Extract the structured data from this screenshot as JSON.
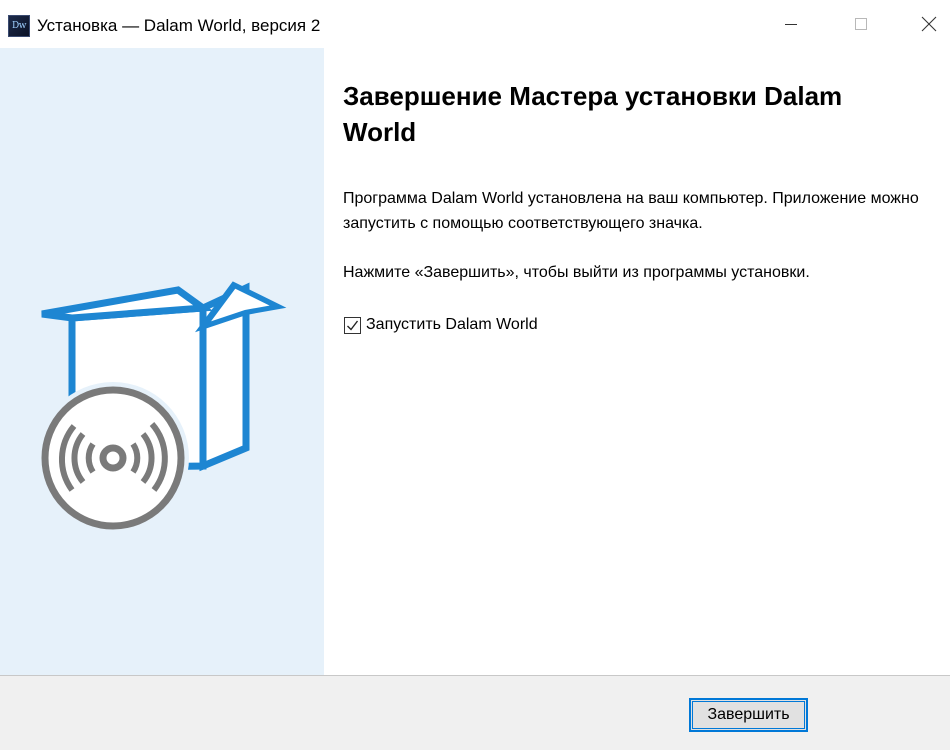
{
  "window": {
    "title": "Установка — Dalam World, версия 2",
    "app_icon_text": "Dw",
    "controls": [
      "minimize-icon",
      "maximize-icon",
      "close-icon"
    ]
  },
  "sidebar": {
    "background": "#e6f1fa",
    "illustration": "software-box-with-disc-icon",
    "accent": "#1e86d2",
    "disc_color": "#7a7a7a"
  },
  "content": {
    "heading": "Завершение Мастера установки Dalam World",
    "paragraph1": "Программа Dalam World установлена на ваш компьютер. Приложение можно запустить с помощью соответствующего значка.",
    "paragraph2": "Нажмите «Завершить», чтобы выйти из программы установки.",
    "launch_checkbox": {
      "label": "Запустить Dalam World",
      "checked": true
    }
  },
  "footer": {
    "finish_label": "Завершить"
  }
}
